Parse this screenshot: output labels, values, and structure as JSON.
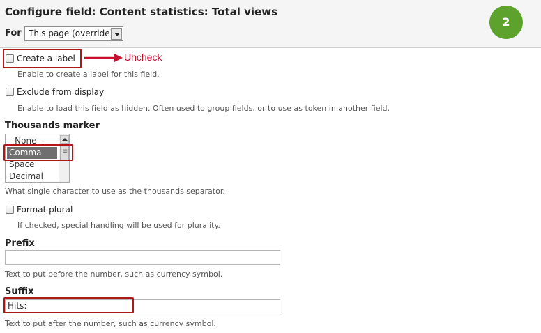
{
  "header": {
    "title": "Configure field: Content statistics: Total views",
    "for_label": "For",
    "for_select_value": "This page (override)",
    "step_badge": "2"
  },
  "annotation": {
    "text": "Uhcheck",
    "color": "#c8102e"
  },
  "fields": {
    "create_label": {
      "label": "Create a label",
      "checked": false,
      "description": "Enable to create a label for this field."
    },
    "exclude": {
      "label": "Exclude from display",
      "checked": false,
      "description": "Enable to load this field as hidden. Often used to group fields, or to use as token in another field."
    },
    "thousands": {
      "label": "Thousands marker",
      "options": [
        "- None -",
        "Comma",
        "Space",
        "Decimal"
      ],
      "selected": "Comma",
      "description": "What single character to use as the thousands separator."
    },
    "format_plural": {
      "label": "Format plural",
      "checked": false,
      "description": "If checked, special handling will be used for plurality."
    },
    "prefix": {
      "label": "Prefix",
      "value": "",
      "description": "Text to put before the number, such as currency symbol."
    },
    "suffix": {
      "label": "Suffix",
      "value": "Hits:",
      "description": "Text to put after the number, such as currency symbol."
    }
  },
  "colors": {
    "header_bg": "#f5f5f5",
    "badge": "#5ca22c",
    "highlight": "#b01818"
  }
}
